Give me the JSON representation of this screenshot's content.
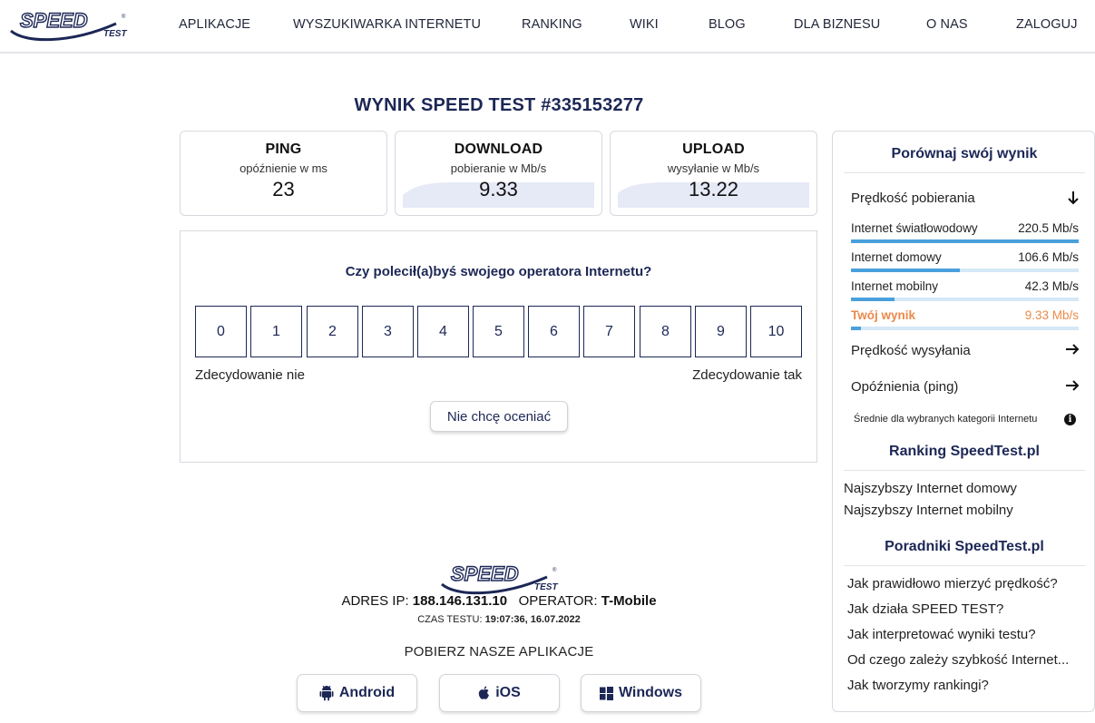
{
  "nav": {
    "logo_text": "SPEED TEST",
    "items": [
      "APLIKACJE",
      "WYSZUKIWARKA INTERNETU",
      "RANKING",
      "WIKI",
      "BLOG",
      "DLA BIZNESU",
      "O NAS",
      "ZALOGUJ"
    ]
  },
  "result": {
    "title": "WYNIK SPEED TEST #335153277",
    "ping": {
      "label": "PING",
      "sub": "opóźnienie w ms",
      "value": "23"
    },
    "download": {
      "label": "DOWNLOAD",
      "sub": "pobieranie w Mb/s",
      "value": "9.33"
    },
    "upload": {
      "label": "UPLOAD",
      "sub": "wysyłanie w Mb/s",
      "value": "13.22"
    }
  },
  "rating": {
    "question": "Czy polecił(a)byś swojego operatora Internetu?",
    "scores": [
      "0",
      "1",
      "2",
      "3",
      "4",
      "5",
      "6",
      "7",
      "8",
      "9",
      "10"
    ],
    "low_label": "Zdecydowanie nie",
    "high_label": "Zdecydowanie tak",
    "skip_label": "Nie chcę oceniać"
  },
  "footer": {
    "ip_label": "ADRES IP:",
    "ip_value": "188.146.131.10",
    "operator_label": "OPERATOR:",
    "operator_value": "T-Mobile",
    "time_label": "CZAS TESTU:",
    "time_value": "19:07:36, 16.07.2022",
    "apps_label": "POBIERZ NASZE APLIKACJE",
    "apps": [
      {
        "label": "Android",
        "icon": "android-icon"
      },
      {
        "label": "iOS",
        "icon": "apple-icon"
      },
      {
        "label": "Windows",
        "icon": "windows-icon"
      }
    ]
  },
  "panel": {
    "compare_title": "Porównaj swój wynik",
    "download_section": "Prędkość pobierania",
    "rows": [
      {
        "label": "Internet światłowodowy",
        "value": "220.5 Mb/s",
        "fraction": 1.0
      },
      {
        "label": "Internet domowy",
        "value": "106.6 Mb/s",
        "fraction": 0.48
      },
      {
        "label": "Internet mobilny",
        "value": "42.3 Mb/s",
        "fraction": 0.19
      },
      {
        "label": "Twój wynik",
        "value": "9.33 Mb/s",
        "fraction": 0.042
      }
    ],
    "upload_section": "Prędkość wysyłania",
    "ping_section": "Opóźnienia (ping)",
    "note": "Średnie dla wybranych kategorii Internetu",
    "ranking_title": "Ranking SpeedTest.pl",
    "ranking_links": [
      "Najszybszy Internet domowy",
      "Najszybszy Internet mobilny"
    ],
    "guides_title": "Poradniki SpeedTest.pl",
    "guides_links": [
      "Jak prawidłowo mierzyć prędkość?",
      "Jak działa SPEED TEST?",
      "Jak interpretować wyniki testu?",
      "Od czego zależy szybkość Internet...",
      "Jak tworzymy rankingi?"
    ]
  },
  "colors": {
    "navy": "#1c2756",
    "accent_blue": "#4aa0dc",
    "your_result": "#ea8a4a"
  }
}
